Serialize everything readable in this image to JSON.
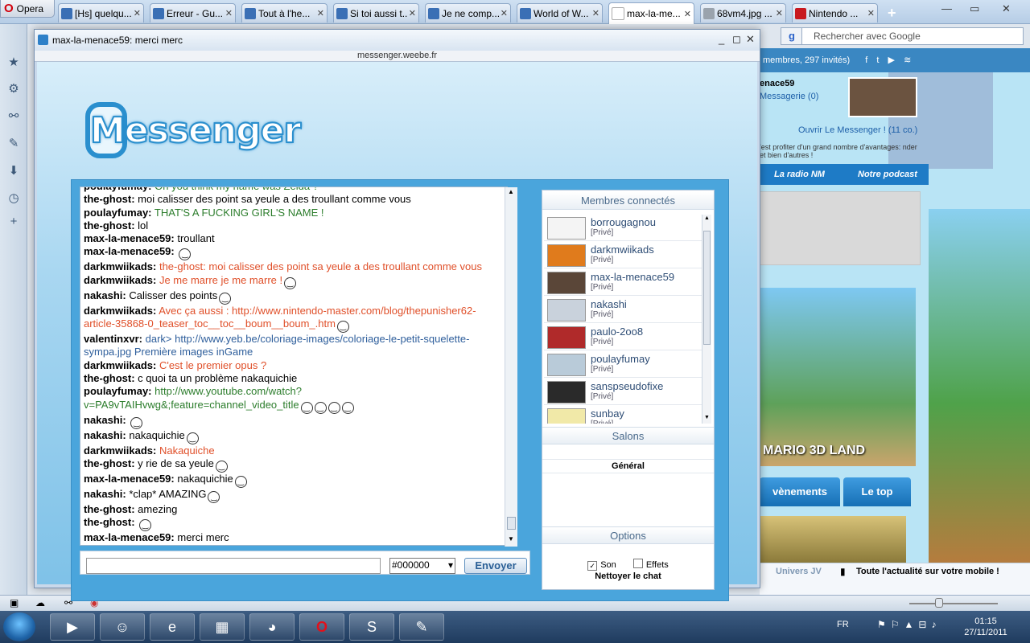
{
  "browser": {
    "app_name": "Opera",
    "tabs": [
      {
        "label": "[Hs] quelqu...",
        "fav": "blue"
      },
      {
        "label": "Erreur - Gu...",
        "fav": "blue"
      },
      {
        "label": "Tout à l'he...",
        "fav": "blue"
      },
      {
        "label": "Si toi aussi t...",
        "fav": "blue"
      },
      {
        "label": "Je ne comp...",
        "fav": "blue"
      },
      {
        "label": "World of W...",
        "fav": "blue"
      },
      {
        "label": "max-la-me...",
        "fav": "blank"
      },
      {
        "label": "68vm4.jpg ...",
        "fav": "gray"
      },
      {
        "label": "Nintendo ...",
        "fav": "red"
      }
    ],
    "search_placeholder": "Rechercher avec Google"
  },
  "site": {
    "members_text": "membres, 297 invités)",
    "user_name": "enace59",
    "messagerie": "Messagerie (0)",
    "open_messenger": "Ouvrir Le Messenger ! (11 co.)",
    "promo": "'est profiter d'un grand nombre d'avantages: nder et bien d'autres !",
    "nav": [
      "La radio NM",
      "Notre podcast"
    ],
    "banner_title": "MARIO 3D LAND",
    "tabs": [
      "vènements",
      "Le top"
    ],
    "footer_left": "Univers JV",
    "footer_right": "Toute l'actualité sur votre mobile !"
  },
  "popup": {
    "title": "max-la-menace59: merci merc",
    "url": "messenger.weebe.fr",
    "logo_text": "Messenger"
  },
  "chat": {
    "messages": [
      {
        "nick": "poulayfumay:",
        "text": "Oh you think my name was Zelda ?",
        "color": "green"
      },
      {
        "nick": "the-ghost:",
        "text": "moi calisser des point sa yeule a des troullant comme vous",
        "color": "black"
      },
      {
        "nick": "poulayfumay:",
        "text": "THAT'S A FUCKING GIRL'S NAME !",
        "color": "green"
      },
      {
        "nick": "the-ghost:",
        "text": "lol",
        "color": "black"
      },
      {
        "nick": "max-la-menace59:",
        "text": "troullant",
        "color": "black"
      },
      {
        "nick": "max-la-menace59:",
        "text": "",
        "color": "black",
        "smileys": 1
      },
      {
        "nick": "darkmwiikads:",
        "text": "the-ghost: moi calisser des point sa yeule a des troullant comme vous",
        "color": "red"
      },
      {
        "nick": "darkmwiikads:",
        "text": "Je me marre je me marre !",
        "color": "red",
        "smileys": 1
      },
      {
        "nick": "nakashi:",
        "text": "Calisser des points",
        "color": "black",
        "smileys": 1
      },
      {
        "nick": "darkmwiikads:",
        "text": "Avec ça aussi : http://www.nintendo-master.com/blog/thepunisher62-article-35868-0_teaser_toc__toc__boum__boum_.htm",
        "color": "red",
        "smileys": 1
      },
      {
        "nick": "valentinxvr:",
        "text": "dark> http://www.yeb.be/coloriage-images/coloriage-le-petit-squelette-sympa.jpg Première images inGame",
        "color": "blue"
      },
      {
        "nick": "darkmwiikads:",
        "text": "C'est le premier opus ?",
        "color": "red"
      },
      {
        "nick": "the-ghost:",
        "text": "c quoi ta un problème nakaquichie",
        "color": "black"
      },
      {
        "nick": "poulayfumay:",
        "text": "http://www.youtube.com/watch?v=PA9vTAIHvwg&;feature=channel_video_title",
        "color": "green",
        "smileys": 4
      },
      {
        "nick": "nakashi:",
        "text": "",
        "color": "black",
        "smileys": 1
      },
      {
        "nick": "nakashi:",
        "text": "nakaquichie",
        "color": "black",
        "smileys": 1
      },
      {
        "nick": "darkmwiikads:",
        "text": "Nakaquiche",
        "color": "red"
      },
      {
        "nick": "the-ghost:",
        "text": "y rie de sa yeule",
        "color": "black",
        "smileys": 1
      },
      {
        "nick": "max-la-menace59:",
        "text": "nakaquichie",
        "color": "black",
        "smileys": 1
      },
      {
        "nick": "nakashi:",
        "text": "*clap* AMAZING",
        "color": "black",
        "smileys": 1
      },
      {
        "nick": "the-ghost:",
        "text": "amezing",
        "color": "black"
      },
      {
        "nick": "the-ghost:",
        "text": "",
        "color": "black",
        "smileys": 1
      },
      {
        "nick": "max-la-menace59:",
        "text": "merci merc",
        "color": "black"
      }
    ],
    "input_value": "",
    "color_value": "#000000",
    "send_label": "Envoyer"
  },
  "sidebar": {
    "members_header": "Membres connectés",
    "members": [
      {
        "name": "borrougagnou",
        "tag": "[Privé]",
        "av": "#f4f4f4"
      },
      {
        "name": "darkmwiikads",
        "tag": "[Privé]",
        "av": "#e07b1c"
      },
      {
        "name": "max-la-menace59",
        "tag": "[Privé]",
        "av": "#5a4638"
      },
      {
        "name": "nakashi",
        "tag": "[Privé]",
        "av": "#c9d2dc"
      },
      {
        "name": "paulo-2oo8",
        "tag": "[Privé]",
        "av": "#b02a2a"
      },
      {
        "name": "poulayfumay",
        "tag": "[Privé]",
        "av": "#b9cbd9"
      },
      {
        "name": "sanspseudofixe",
        "tag": "[Privé]",
        "av": "#2a2a2a"
      },
      {
        "name": "sunbay",
        "tag": "[Privé]",
        "av": "#f1e9a8"
      }
    ],
    "salons_header": "Salons",
    "salon_general": "Général",
    "options_header": "Options",
    "opt_son": "Son",
    "opt_effets": "Effets",
    "clean_chat": "Nettoyer le chat"
  },
  "taskbar": {
    "lang": "FR",
    "time": "01:15",
    "date": "27/11/2011"
  }
}
